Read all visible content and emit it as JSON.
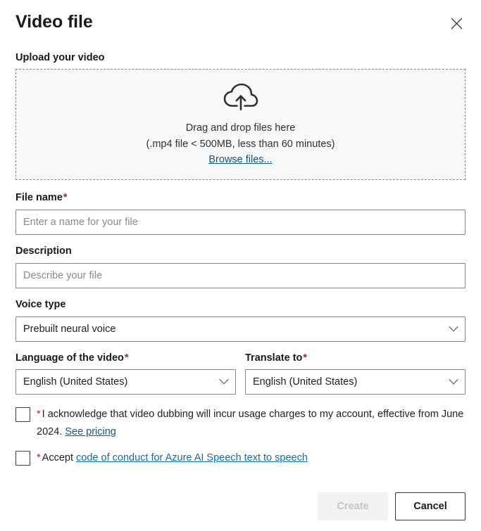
{
  "dialog": {
    "title": "Video file",
    "close_icon": "close-icon"
  },
  "upload": {
    "section_label": "Upload your video",
    "icon": "cloud-upload-icon",
    "drag_text": "Drag and drop files here",
    "constraints_text": "(.mp4 file < 500MB, less than 60 minutes)",
    "browse_label": "Browse files..."
  },
  "file_name": {
    "label": "File name",
    "required_marker": "*",
    "placeholder": "Enter a name for your file",
    "value": ""
  },
  "description": {
    "label": "Description",
    "placeholder": "Describe your file",
    "value": ""
  },
  "voice_type": {
    "label": "Voice type",
    "value": "Prebuilt neural voice",
    "chevron_icon": "chevron-down-icon"
  },
  "language_of_video": {
    "label": "Language of the video",
    "required_marker": "*",
    "value": "English (United States)",
    "chevron_icon": "chevron-down-icon"
  },
  "translate_to": {
    "label": "Translate to",
    "required_marker": "*",
    "value": "English (United States)",
    "chevron_icon": "chevron-down-icon"
  },
  "acknowledge": {
    "required_marker": "*",
    "text": "I acknowledge that video dubbing will incur usage charges to my account, effective from June 2024.",
    "link_label": "See pricing",
    "checked": false
  },
  "code_of_conduct": {
    "required_marker": "*",
    "prefix": "Accept",
    "link_label": "code of conduct for Azure AI Speech text to speech",
    "checked": false
  },
  "footer": {
    "create_label": "Create",
    "cancel_label": "Cancel"
  },
  "colors": {
    "required_red": "#a4262c",
    "link_blue": "#11567f",
    "link_blue_bright": "#0f6cbd",
    "dropzone_bg": "#f7f8f9",
    "disabled_bg": "#f3f2f1",
    "disabled_text": "#c6c4c2"
  }
}
